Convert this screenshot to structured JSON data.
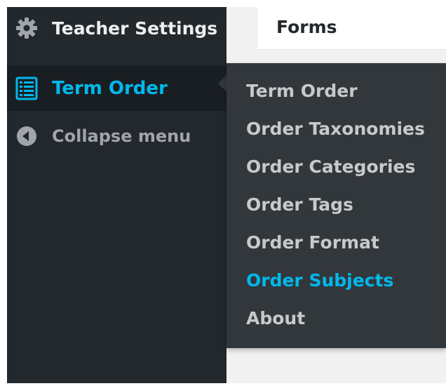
{
  "sidebar": {
    "top_item": {
      "label": "Teacher Settings",
      "icon": "gear-icon"
    },
    "active_item": {
      "label": "Term Order",
      "icon": "list-icon"
    },
    "collapse_item": {
      "label": "Collapse menu",
      "icon": "collapse-arrow-icon"
    }
  },
  "content": {
    "title": "Forms"
  },
  "flyout": {
    "items": [
      {
        "label": "Term Order"
      },
      {
        "label": "Order Taxonomies"
      },
      {
        "label": "Order Categories"
      },
      {
        "label": "Order Tags"
      },
      {
        "label": "Order Format"
      },
      {
        "label": "Order Subjects",
        "current": true
      },
      {
        "label": "About"
      }
    ]
  },
  "colors": {
    "sidebar_bg": "#23282d",
    "flyout_bg": "#32373c",
    "accent": "#00b9eb",
    "text": "#eeeeee"
  }
}
